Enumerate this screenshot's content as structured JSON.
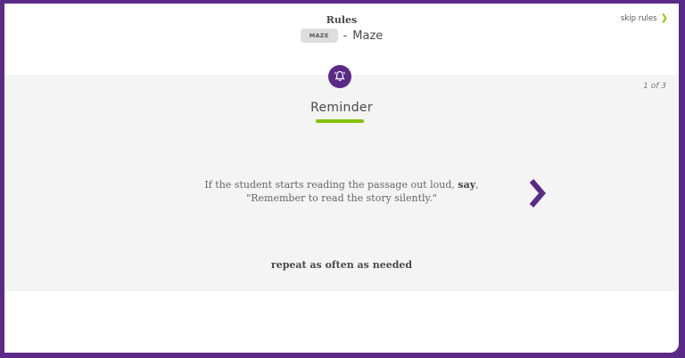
{
  "header": {
    "title": "Rules",
    "module_tag": "MAZE",
    "separator": "-",
    "module_name": "Maze",
    "skip_label": "skip rules",
    "skip_icon": "chevron-right-icon"
  },
  "card": {
    "badge_icon": "bell-icon",
    "counter": "1 of 3",
    "heading": "Reminder",
    "message_part1": "If the student starts reading the passage out loud, ",
    "message_bold": "say",
    "message_part2": ",",
    "message_line2": "\"Remember to read the story silently.\"",
    "footer": "repeat as often as needed",
    "next_icon": "chevron-right-icon"
  },
  "colors": {
    "brand_purple": "#5b2a86",
    "accent_green": "#82c300",
    "panel_gray": "#f4f4f4"
  }
}
